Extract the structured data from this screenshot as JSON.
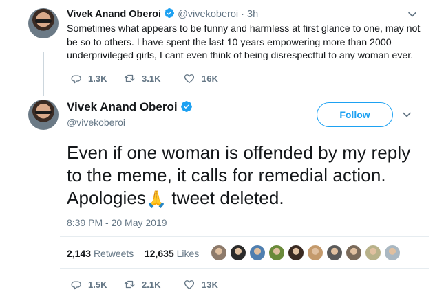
{
  "reply_tweet": {
    "author_name": "Vivek Anand Oberoi",
    "handle": "@vivekoberoi",
    "separator": "·",
    "time": "3h",
    "text": "Sometimes what appears to be funny and harmless at first glance to one, may not be so to others. I have spent the last 10 years empowering more than 2000 underprivileged girls, I cant even think of being disrespectful to any woman ever.",
    "replies": "1.3K",
    "retweets": "3.1K",
    "likes": "16K"
  },
  "main_tweet": {
    "author_name": "Vivek Anand Oberoi",
    "handle": "@vivekoberoi",
    "follow_label": "Follow",
    "text_before_emoji": "Even if one woman is offended by my reply to the meme, it calls for remedial action. Apologies",
    "emoji": "🙏",
    "text_after_emoji": " tweet deleted.",
    "timestamp": "8:39 PM - 20 May 2019",
    "retweet_count": "2,143",
    "retweet_label": "Retweets",
    "like_count": "12,635",
    "like_label": "Likes",
    "replies": "1.5K",
    "retweets": "2.1K",
    "likes": "13K"
  },
  "likers": [
    {
      "icon": "liker-avatar",
      "color": "#8d7a6a"
    },
    {
      "icon": "liker-avatar",
      "color": "#2b2b2b"
    },
    {
      "icon": "liker-avatar",
      "color": "#4f7fb0"
    },
    {
      "icon": "liker-avatar",
      "color": "#6a8a3a"
    },
    {
      "icon": "liker-avatar",
      "color": "#3a2a22"
    },
    {
      "icon": "liker-avatar",
      "color": "#c49a6c"
    },
    {
      "icon": "liker-avatar",
      "color": "#5a5a5a"
    },
    {
      "icon": "liker-avatar",
      "color": "#7a6a5a"
    },
    {
      "icon": "liker-avatar",
      "color": "#b8b28a"
    },
    {
      "icon": "liker-avatar",
      "color": "#aab8c2"
    }
  ],
  "colors": {
    "accent": "#1da1f2",
    "muted": "#657786",
    "text": "#14171a",
    "separator": "#e6ecf0"
  }
}
